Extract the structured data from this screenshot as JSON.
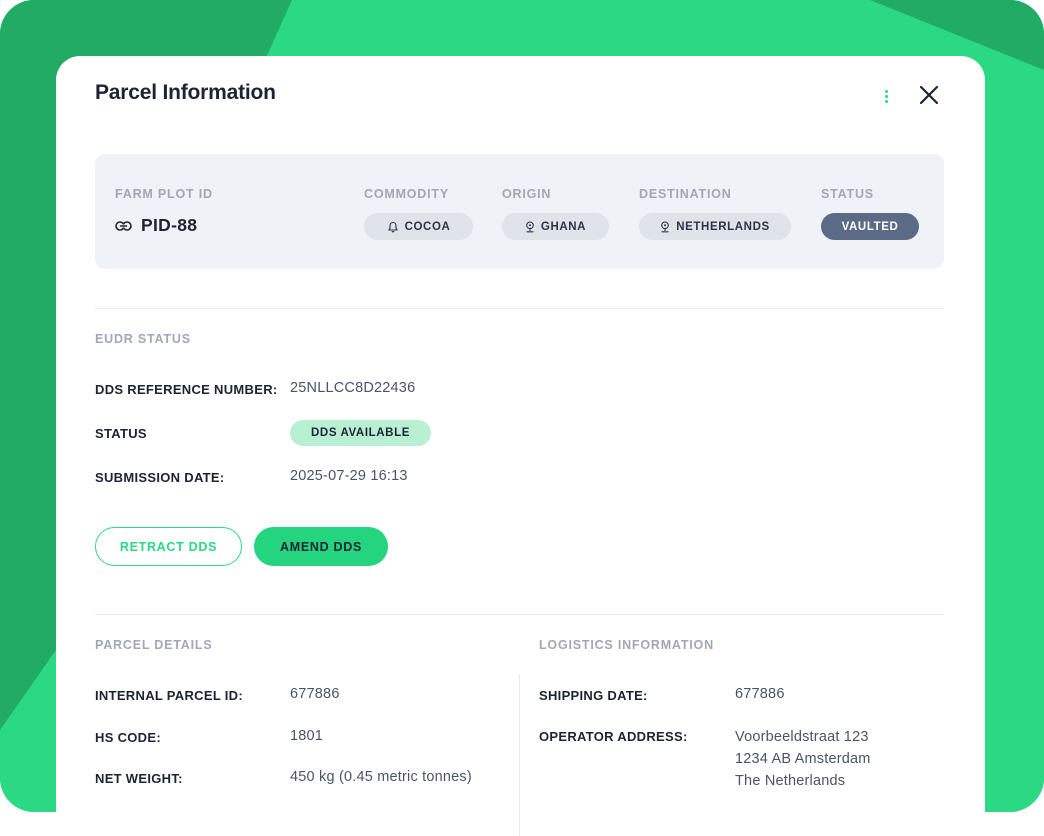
{
  "modal": {
    "title": "Parcel Information"
  },
  "summary": {
    "farm_plot_id_label": "FARM PLOT ID",
    "farm_plot_id": "PID-88",
    "commodity_label": "COMMODITY",
    "commodity": "COCOA",
    "origin_label": "ORIGIN",
    "origin": "GHANA",
    "destination_label": "DESTINATION",
    "destination": "NETHERLANDS",
    "status_label": "STATUS",
    "status": "VAULTED"
  },
  "eudr": {
    "section_title": "EUDR STATUS",
    "dds_ref_label": "DDS REFERENCE NUMBER:",
    "dds_ref_value": "25NLLCC8D22436",
    "status_label": "STATUS",
    "status_value": "DDS AVAILABLE",
    "submission_label": "SUBMISSION DATE:",
    "submission_value": "2025-07-29 16:13",
    "retract_label": "RETRACT DDS",
    "amend_label": "AMEND DDS"
  },
  "parcel_details": {
    "section_title": "PARCEL DETAILS",
    "internal_id_label": "INTERNAL PARCEL ID:",
    "internal_id_value": "677886",
    "hs_code_label": "HS CODE:",
    "hs_code_value": "1801",
    "net_weight_label": "NET WEIGHT:",
    "net_weight_value": "450 kg (0.45 metric tonnes)"
  },
  "logistics": {
    "section_title": "LOGISTICS INFORMATION",
    "shipping_date_label": "SHIPPING DATE:",
    "shipping_date_value": "677886",
    "operator_address_label": "OPERATOR ADDRESS:",
    "operator_address_lines": [
      "Voorbeeldstraat 123",
      "1234 AB Amsterdam",
      "The Netherlands"
    ]
  },
  "icons": {
    "link": "link-icon",
    "commodity": "bell-icon",
    "location": "pin-icon",
    "more": "more-vertical-icon",
    "close": "close-icon"
  },
  "colors": {
    "accent": "#2bd984",
    "background_dark": "#21a862",
    "status_chip": "#5b6b86",
    "available_badge": "#b9f0d4"
  }
}
